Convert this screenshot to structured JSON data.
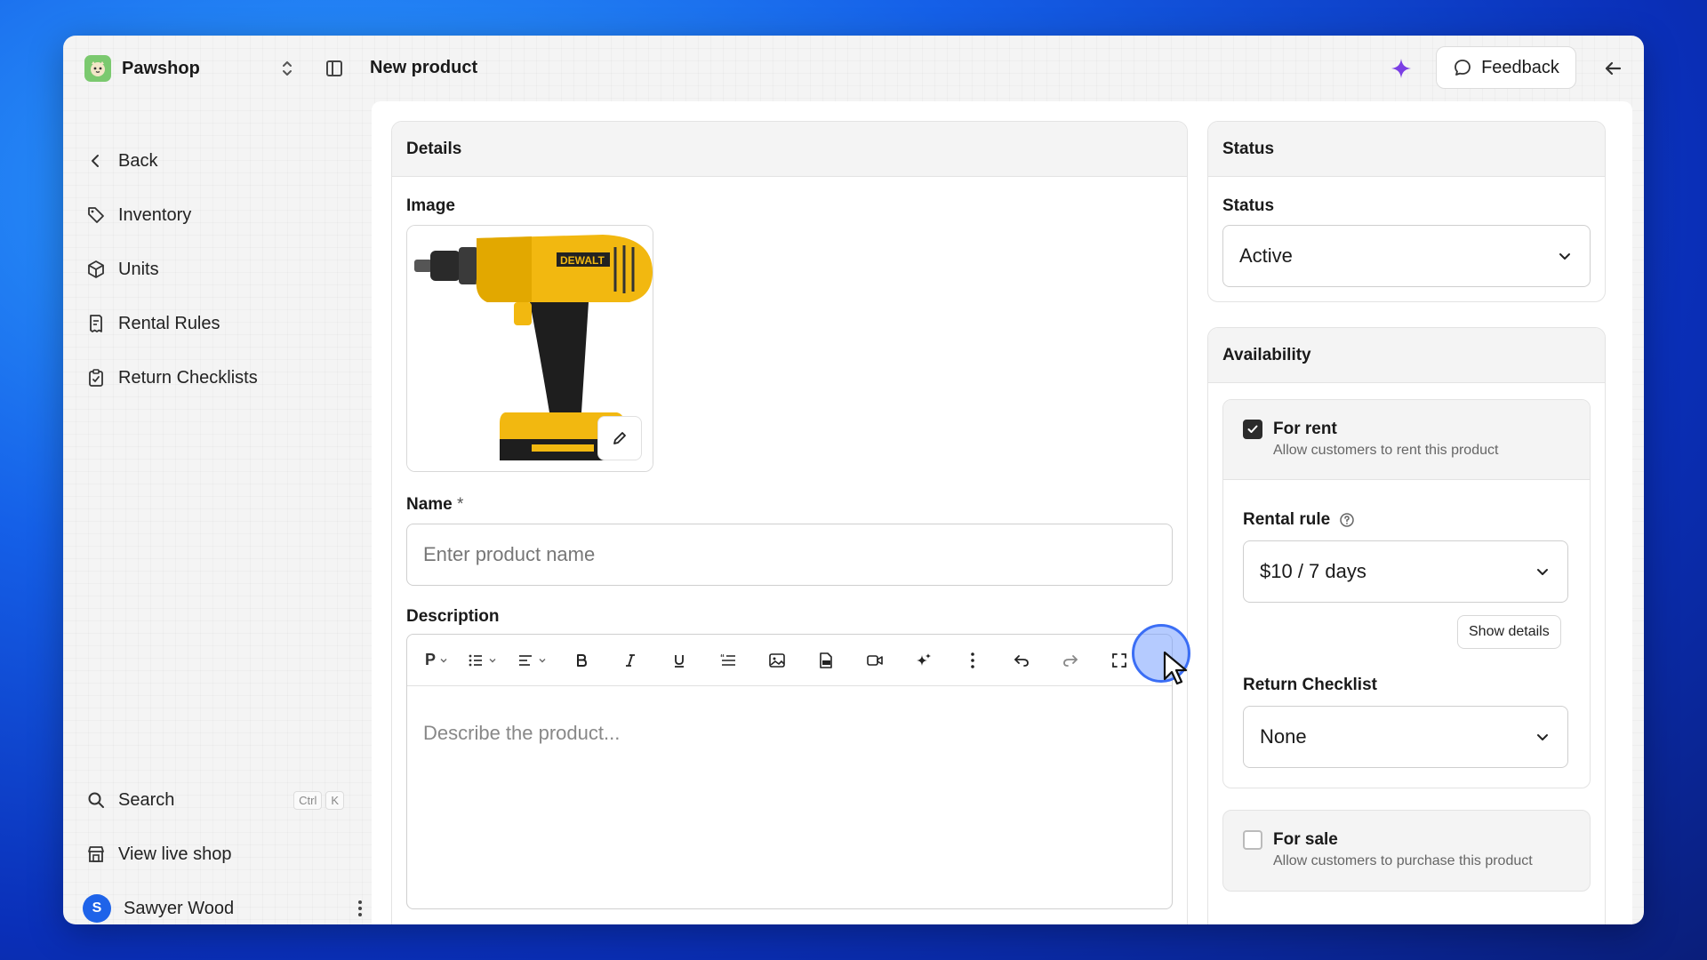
{
  "app": {
    "name": "Pawshop"
  },
  "header": {
    "title": "New product",
    "feedback_label": "Feedback"
  },
  "sidebar": {
    "back_label": "Back",
    "items": [
      {
        "label": "Inventory",
        "icon": "tag-icon"
      },
      {
        "label": "Units",
        "icon": "box-icon"
      },
      {
        "label": "Rental Rules",
        "icon": "receipt-icon"
      },
      {
        "label": "Return Checklists",
        "icon": "clipboard-check-icon"
      }
    ],
    "search_label": "Search",
    "search_shortcut": [
      "Ctrl",
      "K"
    ],
    "view_shop_label": "View live shop",
    "user": {
      "name": "Sawyer Wood",
      "initial": "S"
    }
  },
  "details": {
    "title": "Details",
    "image_label": "Image",
    "name_label": "Name",
    "name_required": "*",
    "name_placeholder": "Enter product name",
    "name_value": "",
    "description_label": "Description",
    "description_placeholder": "Describe the product...",
    "paragraph_style": "P"
  },
  "status": {
    "card_title": "Status",
    "field_label": "Status",
    "value": "Active"
  },
  "availability": {
    "title": "Availability",
    "for_rent": {
      "label": "For rent",
      "description": "Allow customers to rent this product",
      "checked": true
    },
    "rental_rule_label": "Rental rule",
    "rental_rule_value": "$10 / 7 days",
    "show_details_label": "Show details",
    "return_checklist_label": "Return Checklist",
    "return_checklist_value": "None",
    "for_sale": {
      "label": "For sale",
      "description": "Allow customers to purchase this product",
      "checked": false
    }
  },
  "colors": {
    "accent": "#1e63e9",
    "sparkle": "#7b3fe4",
    "checkbox_checked": "#2b2b2b"
  }
}
